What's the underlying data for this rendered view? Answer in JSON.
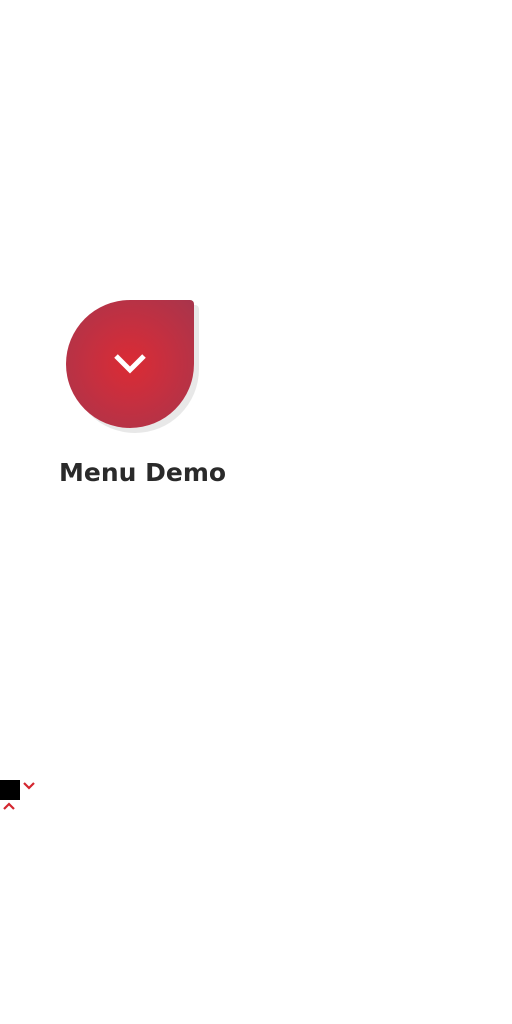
{
  "demo": {
    "title": "Menu Demo"
  },
  "icons": {
    "menu_toggle": "chevron-down-icon",
    "mini_down": "chevron-down-icon",
    "mini_up": "chevron-up-icon"
  },
  "colors": {
    "button_center": "#db2b34",
    "button_edge": "#a7354c",
    "chevron_small": "#d4262f",
    "title_text": "#2a2a2a",
    "swatch": "#000000"
  }
}
